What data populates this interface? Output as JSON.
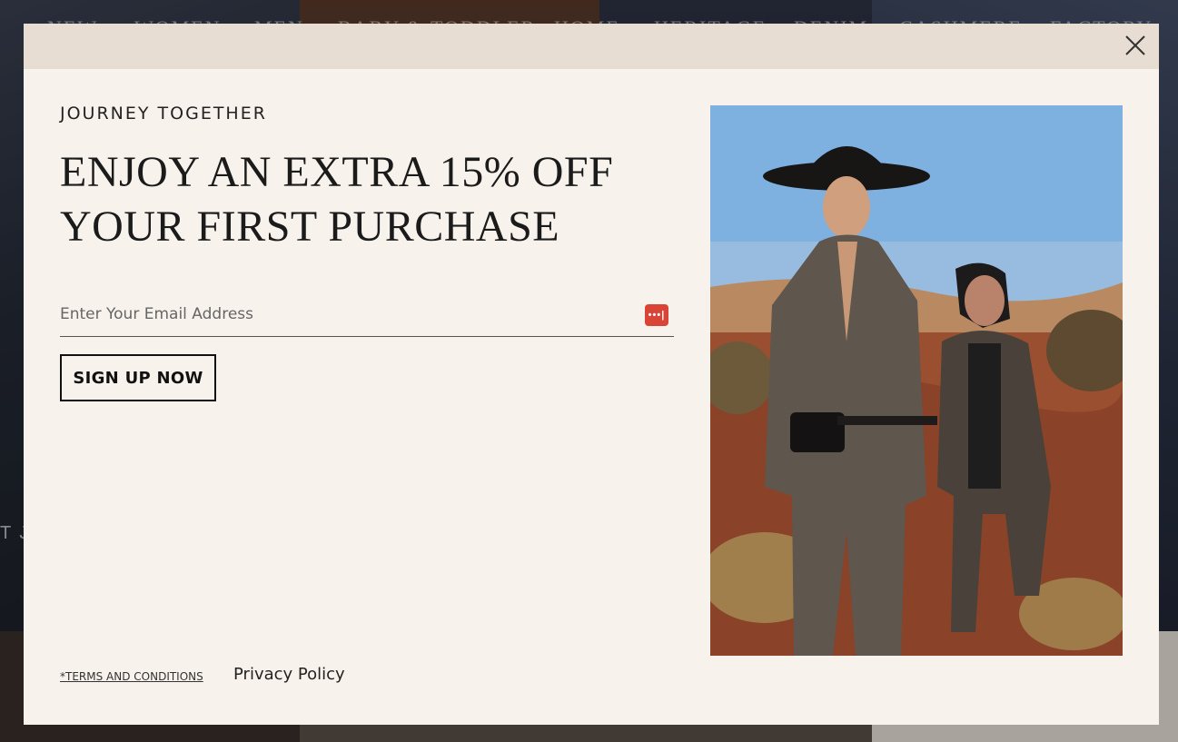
{
  "background": {
    "nav_items": [
      "NEW",
      "WOMEN",
      "MEN",
      "BABY & TODDLER",
      "HOME",
      "HERITAGE",
      "DENIM",
      "CASHMERE",
      "FACTORY"
    ],
    "side_text": "T J"
  },
  "modal": {
    "close_icon": "close-icon",
    "eyebrow": "JOURNEY TOGETHER",
    "headline_line1": "ENJOY AN EXTRA 15% OFF",
    "headline_line2": "YOUR FIRST PURCHASE",
    "email_placeholder": "Enter Your Email Address",
    "email_value": "",
    "password_manager_icon": "password-manager-icon",
    "password_manager_glyph": "•••|",
    "signup_label": "SIGN UP NOW",
    "terms_label": "*TERMS AND CONDITIONS",
    "privacy_label": "Privacy Policy"
  },
  "colors": {
    "modal_bg": "#f7f3ec",
    "modal_header": "#e8ddd2",
    "accent_red": "#d94436"
  }
}
